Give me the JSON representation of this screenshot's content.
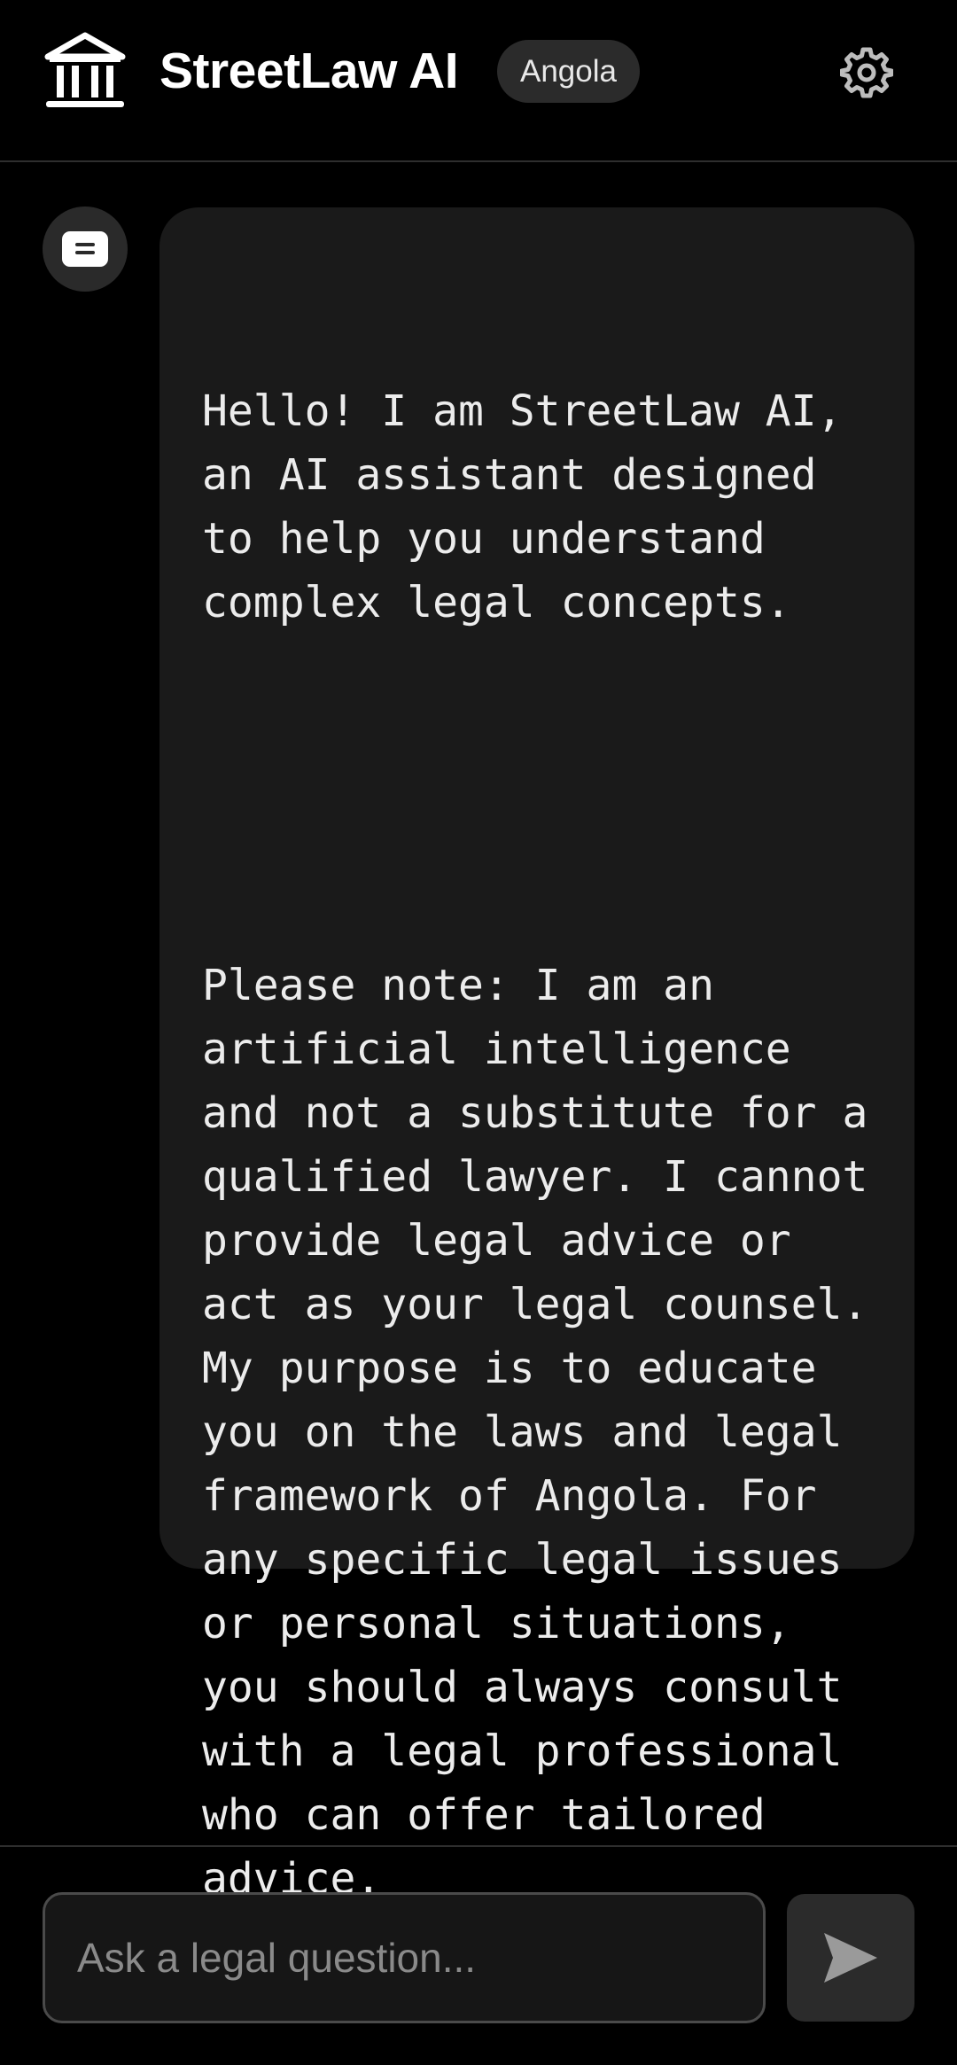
{
  "header": {
    "title": "StreetLaw AI",
    "country_badge": "Angola",
    "logo_icon": "courthouse-icon",
    "settings_icon": "gear-icon"
  },
  "chat": {
    "messages": [
      {
        "sender_icon": "chat-bubble-icon",
        "paragraphs": [
          "Hello! I am StreetLaw AI, an AI assistant designed to help you understand complex legal concepts.",
          "Please note: I am an artificial intelligence and not a substitute for a qualified lawyer. I cannot provide legal advice or act as your legal counsel. My purpose is to educate you on the laws and legal framework of Angola. For any specific legal issues or personal situations, you should always consult with a legal professional who can offer tailored advice."
        ]
      }
    ]
  },
  "composer": {
    "placeholder": "Ask a legal question...",
    "value": "",
    "send_icon": "send-icon"
  },
  "colors": {
    "background": "#000000",
    "bubble": "#1a1a1a",
    "badge": "#2b2b2b",
    "divider": "#2e2e2e"
  }
}
